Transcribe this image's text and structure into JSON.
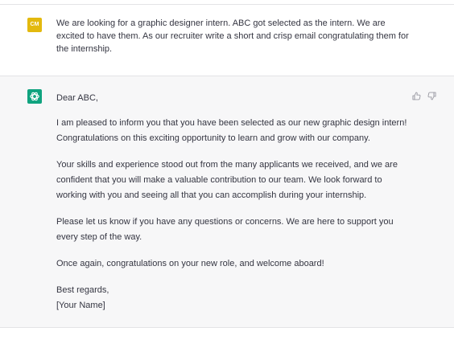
{
  "colors": {
    "user_avatar_bg": "#e3b90e",
    "assistant_icon_bg": "#10a37f",
    "text": "#343541",
    "icon_gray": "#9a9aa3"
  },
  "user_message": {
    "avatar_initials": "CM",
    "text": "We are looking for a graphic designer intern. ABC got selected as the intern. We are excited to have them. As our recruiter write a short and crisp email congratulating them for the internship."
  },
  "assistant_message": {
    "icon": "openai-logo-icon",
    "greeting": "Dear ABC,",
    "paragraphs": [
      "I am pleased to inform you that you have been selected as our new graphic design intern! Congratulations on this exciting opportunity to learn and grow with our company.",
      "Your skills and experience stood out from the many applicants we received, and we are confident that you will make a valuable contribution to our team. We look forward to working with you and seeing all that you can accomplish during your internship.",
      "Please let us know if you have any questions or concerns. We are here to support you every step of the way.",
      "Once again, congratulations on your new role, and welcome aboard!"
    ],
    "closing": "Best regards,",
    "signature": "[Your Name]",
    "feedback": {
      "thumbs_up": "thumbs-up-icon",
      "thumbs_down": "thumbs-down-icon"
    }
  }
}
